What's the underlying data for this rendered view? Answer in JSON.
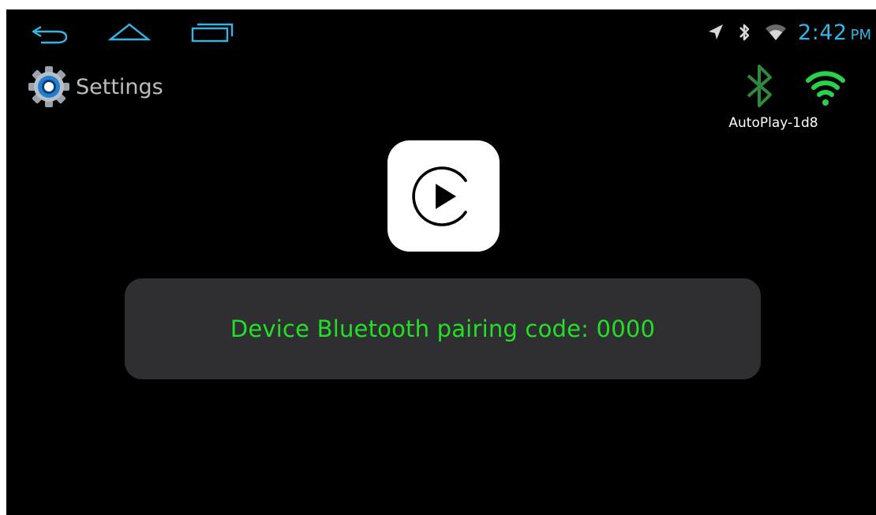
{
  "status_bar": {
    "time": "2:42",
    "ampm": "PM",
    "icons": [
      "location-arrow-icon",
      "bluetooth-icon",
      "wifi-icon"
    ]
  },
  "nav": {
    "buttons": [
      "back-icon",
      "home-icon",
      "recent-apps-icon"
    ]
  },
  "settings": {
    "label": "Settings",
    "icon": "gear-icon"
  },
  "connection": {
    "device_name": "AutoPlay-1d8",
    "bluetooth_color": "#2e8b3e",
    "wifi_color": "#2bd14a"
  },
  "app": {
    "icon": "play-icon"
  },
  "message": {
    "text": "Device Bluetooth pairing code: 0000",
    "color": "#22e022"
  },
  "colors": {
    "accent": "#33b5e5",
    "background": "#000000",
    "panel": "#2f2f33"
  }
}
